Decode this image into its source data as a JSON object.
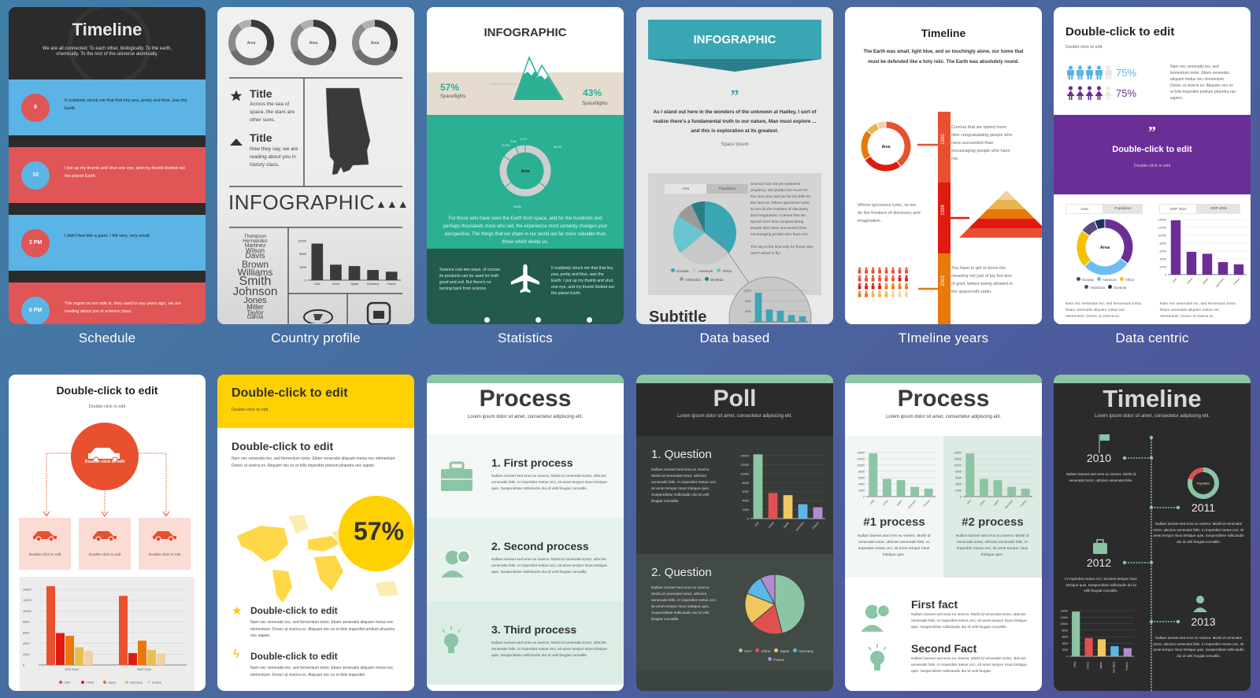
{
  "templates": [
    {
      "label": "Schedule",
      "header": {
        "title": "Timeline",
        "subtitle": "We are all connected; To each other, biologically. To the earth, chemically. To the rest of the universe atomically."
      },
      "entries": [
        {
          "badge": "9",
          "text": "It suddenly struck me that that tiny pea, pretty and blue, was the Earth."
        },
        {
          "badge": "10",
          "text": "I put up my thumb and shut one eye, and my thumb blotted out the planet Earth."
        },
        {
          "badge": "3 PM",
          "text": "I didn't feel like a giant. I felt very, very small."
        },
        {
          "badge": "6 PM",
          "text": "The regret on our side is, they used to say years ago, we are reading about you in science class."
        }
      ],
      "colors": {
        "dark": "#2b2b2b",
        "blue": "#5bb4e5",
        "red": "#e05555"
      }
    },
    {
      "label": "Country profile",
      "donut_label": "Area",
      "items": [
        {
          "icon": "star",
          "title": "Title",
          "text": "Across the sea of space, the stars are other suns."
        },
        {
          "icon": "triangle",
          "title": "Title",
          "text": "Now they say, we are reading about you in history class."
        }
      ],
      "banner": "INFOGRAPHIC",
      "names": [
        "Thompson",
        "Hernandez",
        "Martinez",
        "Wilson",
        "Davis",
        "Brown",
        "Williams",
        "Smith",
        "Johnson",
        "Jones",
        "Miller",
        "Taylor",
        "Garcia"
      ],
      "chart": {
        "ticks": [
          "12000",
          "8000",
          "4000",
          "0"
        ],
        "categories": [
          "USA",
          "China",
          "Japan",
          "Germany",
          "France"
        ],
        "values": [
          13000,
          5500,
          5000,
          3600,
          3000
        ],
        "max": 14000
      }
    },
    {
      "label": "Statistics",
      "title": "INFOGRAPHIC",
      "left_stat": {
        "value": "57%",
        "caption": "Spaceflights"
      },
      "right_stat": {
        "value": "43%",
        "caption": "Spaceflights"
      },
      "donut": {
        "center": "Area",
        "labels": [
          "6.1%",
          "9.5%",
          "20.5%",
          "36.2%",
          "28.5%"
        ],
        "values": [
          36.2,
          28.5,
          20.5,
          9.5,
          6.1
        ]
      },
      "paragraph": "For those who have seen the Earth from space, and for the hundreds and perhaps thousands more who will, the experience most certainly changes your perspective. The things that we share in our world are far more valuable than those which divide us.",
      "left_text": "Science cuts two ways, of course; its products can be used for both good and evil. But there's no turning back from science.",
      "right_text": "It suddenly struck me that that tiny pea, pretty and blue, was the Earth. I put up my thumb and shut one eye, and my thumb blotted out the planet Earth."
    },
    {
      "label": "Data based",
      "banner": "INFOGRAPHIC",
      "quote": "As I stand out here in the wonders of the unknown at Hadley, I sort of realize there's a fundamental truth to our nature, Man must explore ... and this is exploration at its greatest.",
      "author": "Space Ipsum",
      "tabs": [
        "Area",
        "Population"
      ],
      "side_text": "Science has not yet mastered prophecy. We predict too much for the next year and yet far too little for the next 10. Where ignorance lurks, so too do the frontiers of discovery and imagination. Curious that we spend more time congratulating people who have succeeded than encouraging people who have not.",
      "side_text2": "The sky is the limit only for those who aren't afraid to fly!",
      "legend": [
        "Eurasia",
        "Americas",
        "Africa",
        "Antarctica",
        "Oceania"
      ],
      "pie_values": [
        36,
        28,
        20,
        9,
        7
      ],
      "pie_colors": [
        "#3aa6b4",
        "#c8c8c8",
        "#6ac4cf",
        "#9a9a9a",
        "#2a7c86"
      ],
      "mini_ticks": [
        "12000",
        "8000",
        "4000",
        "0"
      ],
      "mini_values": [
        13000,
        5500,
        5000,
        3000,
        2500
      ],
      "subtitle": "Subtitle"
    },
    {
      "label": "TImeline years",
      "title": "Timeline",
      "intro": "The Earth was small, light blue, and so touchingly alone, our home that must be defended like a holy relic. The Earth was absolutely round.",
      "years": [
        "1990",
        "1998",
        "2003"
      ],
      "donut_label": "Area",
      "texts": [
        "Curious that we spend more time congratulating people who have succeeded than encouraging people who have not.",
        "Where ignorance lurks, so too do the frontiers of discovery and imagination.",
        "You have to get to know the meaning not just of joy but also of grief, before being allowed in the spacecraft cabin."
      ],
      "colors": [
        "#e8502f",
        "#e01a10",
        "#e8790a",
        "#e8b64c",
        "#f2d0a8"
      ]
    },
    {
      "label": "Data centric",
      "title": "Double-click to edit",
      "subtitle": "Double-click to edit",
      "stats": [
        {
          "value": "75%",
          "filled": 4,
          "total": 5
        },
        {
          "value": "75%",
          "filled": 4,
          "total": 5
        }
      ],
      "side_text": "Nam nec venenatis leo, sed fermentum tortor. Etiam venenatis aliquam metus nec elementum. Donec ut viverra ex. Aliquam nec ex et felis imperdiet pretium pharetra nec sapien.",
      "quote_title": "Double-click to edit",
      "quote_sub": "Double-click to edit",
      "tabs_left": [
        "Area",
        "Population"
      ],
      "tabs_right": [
        "GDP 2010",
        "GDP 2005"
      ],
      "donut_center": "Area",
      "donut_values": [
        35,
        28,
        22,
        9,
        6
      ],
      "donut_colors": [
        "#6b2d96",
        "#6cbcf5",
        "#f5c000",
        "#5a4a80",
        "#213060"
      ],
      "legend": [
        "Eurasia",
        "Americas",
        "Africa",
        "Antarctica",
        "Oceania"
      ],
      "bar_ticks": [
        "14000",
        "12000",
        "10000",
        "8000",
        "6000",
        "4000",
        "2000",
        "0"
      ],
      "bar_categories": [
        "USA",
        "China",
        "Japan",
        "Germany",
        "France"
      ],
      "bar_values": [
        14300,
        6000,
        5500,
        3300,
        2700
      ],
      "footer_text": "Nam nec venenatis leo, sed fermentum tortor. Etiam venenatis aliquam metus nec elementum. Donec ut viverra ex.",
      "accent": "#6b2d96"
    },
    {
      "label": "",
      "title": "Double-click to edit",
      "subtitle": "Double-click to edit",
      "center_label": "Double-click to edit",
      "boxes": [
        "Double-click to edit",
        "Double-click to edit",
        "Double-click to edit"
      ],
      "chart": {
        "ticks": [
          "14000",
          "12000",
          "10000",
          "8000",
          "6000",
          "4000",
          "2000",
          "0"
        ],
        "groups": [
          "GDP 2010",
          "GDP 2005"
        ],
        "series": [
          {
            "name": "USA",
            "color": "#e8502f",
            "values": [
              14600,
              12800
            ]
          },
          {
            "name": "China",
            "color": "#e01a10",
            "values": [
              5900,
              2200
            ]
          },
          {
            "name": "Japan",
            "color": "#e8790a",
            "values": [
              5400,
              4500
            ]
          },
          {
            "name": "Germany",
            "color": "#e8c050",
            "values": [
              3300,
              2800
            ]
          },
          {
            "name": "France",
            "color": "#f2d0a8",
            "values": [
              2600,
              2100
            ]
          }
        ],
        "max": 14000
      },
      "accent": "#e8502f"
    },
    {
      "label": "",
      "header_title": "Double-click to edit",
      "header_sub": "Double-click to edit",
      "section_title": "Double-click to edit",
      "section_text": "Nam nec venenatis leo, sed fermentum tortor. Etiam venenatis aliquam metus nec elementum. Donec ut viverra ex. Aliquam nec ex et felis imperdiet pretium pharetra nec sapien.",
      "big_stat": "57%",
      "items": [
        {
          "icon": "star",
          "title": "Double-click to edit",
          "text": "Nam nec venenatis leo, sed fermentum tortor. Etiam venenatis aliquam metus nec elementum. Donec ut viverra ex. Aliquam nec ex et felis imperdiet pretium pharetra nec sapien."
        },
        {
          "icon": "lightning",
          "title": "Double-click to edit",
          "text": "Nam nec venenatis leo, sed fermentum tortor. Etiam venenatis aliquam metus nec elementum. Donec ut viverra ex. Aliquam nec ex et felis imperdiet"
        }
      ],
      "accent": "#ffd100"
    },
    {
      "label": "",
      "title": "Process",
      "subtitle": "Lorem ipsum dolor sit amet, consectetur adipiscing elit.",
      "steps": [
        {
          "icon": "briefcase",
          "title": "1. First process",
          "text": "Nullam laoreet sed eros eu viverra. Morbi id venenatis tortor, ultricies venenatis felis. In imperdiet metus orci, sit amet tempor risus tristique quis. Suspendisse sollicitudin dui id velit feugiat convallis."
        },
        {
          "icon": "person-chat",
          "title": "2. Second process",
          "text": "Nullam laoreet sed eros eu viverra. Morbi id venenatis tortor, ultricies venenatis felis. In imperdiet metus orci, sit amet tempor risus tristique quis. Suspendisse sollicitudin dui id velit feugiat convallis."
        },
        {
          "icon": "lightbulb",
          "title": "3. Third process",
          "text": "Nullam laoreet sed eros eu viverra. Morbi id venenatis tortor, ultricies venenatis felis. In imperdiet metus orci, sit amet tempor risus tristique quis. Suspendisse sollicitudin dui id velit feugiat convallis."
        }
      ],
      "accent": "#8cc5a5"
    },
    {
      "label": "",
      "title": "Poll",
      "subtitle": "Lorem ipsum dolor sit amet, consectetur adipiscing elit.",
      "questions": [
        {
          "title": "1. Question",
          "text": "Nullam laoreet sed eros eu viverra. Morbi id venenatis tortor, ultricies venenatis felis. In imperdiet metus orci, sit amet tempor risus tristique quis. Suspendisse sollicitudin dui id velit feugiat convallis."
        },
        {
          "title": "2. Question",
          "text": "Nullam laoreet sed eros eu viverra. Morbi id venenatis tortor, ultricies venenatis felis. In imperdiet metus orci, sit amet tempor risus tristique quis. Suspendisse sollicitudin dui id velit feugiat convallis."
        }
      ],
      "bar_ticks": [
        "14000",
        "12000",
        "10000",
        "8000",
        "6000",
        "4000",
        "2000",
        "0"
      ],
      "categories": [
        "USA",
        "China",
        "Japan",
        "Germany",
        "France"
      ],
      "bar_values": [
        14800,
        5900,
        5400,
        3300,
        2600
      ],
      "pie_values": [
        46,
        18,
        17,
        11,
        8
      ],
      "colors": [
        "#8cc5a5",
        "#e05050",
        "#f0c860",
        "#5ab8e8",
        "#b08cd0"
      ],
      "legend": [
        "USA",
        "China",
        "Japan",
        "Germany",
        "France"
      ]
    },
    {
      "label": "",
      "title": "Process",
      "subtitle": "Lorem ipsum dolor sit amet, consectetur adipiscing elit.",
      "charts": [
        {
          "title": "#1 process",
          "text": "Nullam laoreet sed eros eu viverra. Morbi id venenatis tortor, ultricies venenatis felis. In imperdiet metus orci, sit amet tempor risus tristique quis."
        },
        {
          "title": "#2 process",
          "text": "Nullam laoreet sed eros eu viverra. Morbi id venenatis tortor, ultricies venenatis felis. In imperdiet metus orci, sit amet tempor risus tristique quis."
        }
      ],
      "bar_ticks": [
        "14000",
        "12000",
        "10000",
        "8000",
        "6000",
        "4000",
        "2000",
        "0"
      ],
      "categories": [
        "USA",
        "China",
        "Japan",
        "Germany",
        "France"
      ],
      "bar_values": [
        14200,
        5800,
        5400,
        3200,
        2600
      ],
      "facts": [
        {
          "icon": "person-chat",
          "title": "First fact",
          "text": "Nullam laoreet sed eros eu viverra. Morbi id venenatis tortor, ultricies venenatis felis. In imperdiet metus orci, sit amet tempor risus tristique quis. Suspendisse sollicitudin dui id velit feugiat convallis."
        },
        {
          "icon": "lightbulb",
          "title": "Second Fact",
          "text": "Nullam laoreet sed eros eu viverra. Morbi id venenatis tortor, ultricies venenatis felis. In imperdiet metus orci, sit amet tempor risus tristique quis. Suspendisse sollicitudin dui id velit feugiat"
        }
      ],
      "accent": "#8cc5a5"
    },
    {
      "label": "",
      "title": "Timeline",
      "subtitle": "Lorem ipsum dolor sit amet, consectetur adipiscing elit.",
      "events": [
        {
          "year": "2010",
          "icon": "flag",
          "text": "Nullam laoreet sed eros eu viverra. Morbi id venenatis tortor, ultricies venenatis felis."
        },
        {
          "year": "2011",
          "icon": "donut",
          "text": "Nullam laoreet sed eros eu viverra. Morbi id venenatis tortor, ultricies venenatis felis. In imperdiet metus orci, sit amet tempor risus tristique quis. Suspendisse sollicitudin dui id velit feugiat convallis."
        },
        {
          "year": "2012",
          "icon": "briefcase",
          "text": "In imperdiet metus orci, sit amet tempor risus tristique quis. Suspendisse sollicitudin dui id velit feugiat convallis."
        },
        {
          "year": "2013",
          "icon": "person-chat",
          "text": "Nullam laoreet sed eros eu viverra. Morbi id venenatis tortor, ultricies venenatis felis. In imperdiet metus orci, sit amet tempor risus tristique quis. Suspendisse sollicitudin dui id velit feugiat convallis."
        }
      ],
      "donut_label": "Population",
      "donut_fraction": 0.2,
      "bar_ticks": [
        "14000",
        "12000",
        "10000",
        "8000",
        "6000",
        "4000",
        "2000",
        "0"
      ],
      "categories": [
        "USA",
        "China",
        "Japan",
        "Germany",
        "France"
      ],
      "bar_values": [
        14200,
        5800,
        5400,
        3200,
        2600
      ],
      "colors": [
        "#8cc5a5",
        "#e05050",
        "#f0c860",
        "#5ab8e8",
        "#b08cd0"
      ]
    }
  ]
}
